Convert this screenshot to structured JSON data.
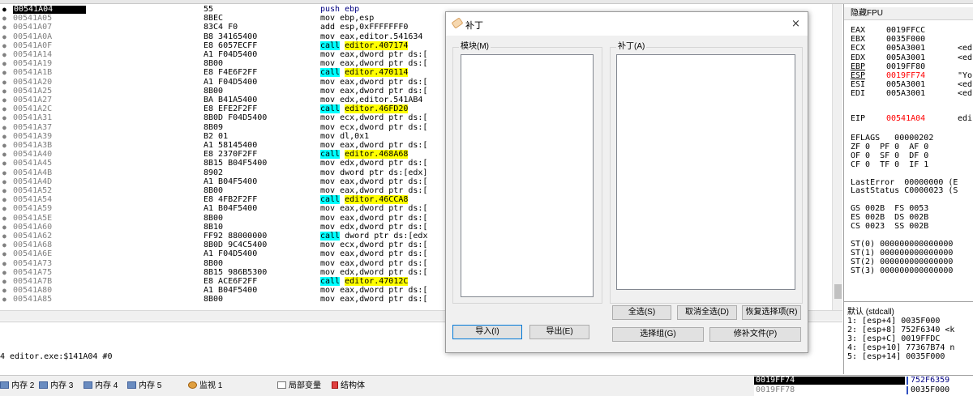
{
  "disasm_rows": [
    {
      "addr": "00541A04",
      "hex": "55",
      "ins": [
        [
          "kw",
          "push ebp"
        ]
      ],
      "sel": true
    },
    {
      "addr": "00541A05",
      "hex": "8BEC",
      "ins": [
        [
          "t",
          "mov ebp,esp"
        ]
      ]
    },
    {
      "addr": "00541A07",
      "hex": "83C4 F0",
      "ins": [
        [
          "t",
          "add esp,0xFFFFFFF0"
        ]
      ]
    },
    {
      "addr": "00541A0A",
      "hex": "B8 34165400",
      "ins": [
        [
          "t",
          "mov eax,editor.541634"
        ]
      ]
    },
    {
      "addr": "00541A0F",
      "hex": "E8 6057ECFF",
      "ins": [
        [
          "call",
          "call"
        ],
        [
          "t",
          " "
        ],
        [
          "tgt",
          "editor.407174"
        ]
      ]
    },
    {
      "addr": "00541A14",
      "hex": "A1 F04D5400",
      "ins": [
        [
          "t",
          "mov eax,dword ptr ds:["
        ]
      ]
    },
    {
      "addr": "00541A19",
      "hex": "8B00",
      "ins": [
        [
          "t",
          "mov eax,dword ptr ds:["
        ]
      ]
    },
    {
      "addr": "00541A1B",
      "hex": "E8 F4E6F2FF",
      "ins": [
        [
          "call",
          "call"
        ],
        [
          "t",
          " "
        ],
        [
          "tgt",
          "editor.470114"
        ]
      ]
    },
    {
      "addr": "00541A20",
      "hex": "A1 F04D5400",
      "ins": [
        [
          "t",
          "mov eax,dword ptr ds:["
        ]
      ]
    },
    {
      "addr": "00541A25",
      "hex": "8B00",
      "ins": [
        [
          "t",
          "mov eax,dword ptr ds:["
        ]
      ]
    },
    {
      "addr": "00541A27",
      "hex": "BA B41A5400",
      "ins": [
        [
          "t",
          "mov edx,editor.541AB4"
        ]
      ]
    },
    {
      "addr": "00541A2C",
      "hex": "E8 EFE2F2FF",
      "ins": [
        [
          "call",
          "call"
        ],
        [
          "t",
          " "
        ],
        [
          "tgt",
          "editor.46FD20"
        ]
      ]
    },
    {
      "addr": "00541A31",
      "hex": "8B0D F04D5400",
      "ins": [
        [
          "t",
          "mov ecx,dword ptr ds:["
        ]
      ]
    },
    {
      "addr": "00541A37",
      "hex": "8B09",
      "ins": [
        [
          "t",
          "mov ecx,dword ptr ds:["
        ]
      ]
    },
    {
      "addr": "00541A39",
      "hex": "B2 01",
      "ins": [
        [
          "t",
          "mov dl,0x1"
        ]
      ]
    },
    {
      "addr": "00541A3B",
      "hex": "A1 58145400",
      "ins": [
        [
          "t",
          "mov eax,dword ptr ds:["
        ]
      ]
    },
    {
      "addr": "00541A40",
      "hex": "E8 2370F2FF",
      "ins": [
        [
          "call",
          "call"
        ],
        [
          "t",
          " "
        ],
        [
          "tgt",
          "editor.468A68"
        ]
      ]
    },
    {
      "addr": "00541A45",
      "hex": "8B15 B04F5400",
      "ins": [
        [
          "t",
          "mov edx,dword ptr ds:["
        ]
      ]
    },
    {
      "addr": "00541A4B",
      "hex": "8902",
      "ins": [
        [
          "t",
          "mov dword ptr ds:[edx]"
        ]
      ]
    },
    {
      "addr": "00541A4D",
      "hex": "A1 B04F5400",
      "ins": [
        [
          "t",
          "mov eax,dword ptr ds:["
        ]
      ]
    },
    {
      "addr": "00541A52",
      "hex": "8B00",
      "ins": [
        [
          "t",
          "mov eax,dword ptr ds:["
        ]
      ]
    },
    {
      "addr": "00541A54",
      "hex": "E8 4FB2F2FF",
      "ins": [
        [
          "call",
          "call"
        ],
        [
          "t",
          " "
        ],
        [
          "tgt",
          "editor.46CCA8"
        ]
      ]
    },
    {
      "addr": "00541A59",
      "hex": "A1 B04F5400",
      "ins": [
        [
          "t",
          "mov eax,dword ptr ds:["
        ]
      ]
    },
    {
      "addr": "00541A5E",
      "hex": "8B00",
      "ins": [
        [
          "t",
          "mov eax,dword ptr ds:["
        ]
      ]
    },
    {
      "addr": "00541A60",
      "hex": "8B10",
      "ins": [
        [
          "t",
          "mov edx,dword ptr ds:["
        ]
      ]
    },
    {
      "addr": "00541A62",
      "hex": "FF92 88000000",
      "ins": [
        [
          "call",
          "call"
        ],
        [
          "t",
          " dword ptr ds:[edx"
        ]
      ]
    },
    {
      "addr": "00541A68",
      "hex": "8B0D 9C4C5400",
      "ins": [
        [
          "t",
          "mov ecx,dword ptr ds:["
        ]
      ]
    },
    {
      "addr": "00541A6E",
      "hex": "A1 F04D5400",
      "ins": [
        [
          "t",
          "mov eax,dword ptr ds:["
        ]
      ]
    },
    {
      "addr": "00541A73",
      "hex": "8B00",
      "ins": [
        [
          "t",
          "mov eax,dword ptr ds:["
        ]
      ]
    },
    {
      "addr": "00541A75",
      "hex": "8B15 986B5300",
      "ins": [
        [
          "t",
          "mov edx,dword ptr ds:["
        ]
      ]
    },
    {
      "addr": "00541A7B",
      "hex": "E8 ACE6F2FF",
      "ins": [
        [
          "call",
          "call"
        ],
        [
          "t",
          " "
        ],
        [
          "tgt",
          "editor.47012C"
        ]
      ]
    },
    {
      "addr": "00541A80",
      "hex": "A1 B04F5400",
      "ins": [
        [
          "t",
          "mov eax,dword ptr ds:["
        ]
      ]
    },
    {
      "addr": "00541A85",
      "hex": "8B00",
      "ins": [
        [
          "t",
          "mov eax,dword ptr ds:["
        ]
      ]
    }
  ],
  "status_line": "4 editor.exe:$141A04 #0",
  "registers": {
    "header": "隐藏FPU",
    "gp": [
      {
        "name": "EAX",
        "value": "0019FFCC",
        "comment": ""
      },
      {
        "name": "EBX",
        "value": "0035F000",
        "comment": ""
      },
      {
        "name": "ECX",
        "value": "005A3001",
        "comment": "<ed"
      },
      {
        "name": "EDX",
        "value": "005A3001",
        "comment": "<ed"
      },
      {
        "name": "EBP",
        "value": "0019FF80",
        "comment": "",
        "underline": true
      },
      {
        "name": "ESP",
        "value": "0019FF74",
        "comment": "\"Yo",
        "underline": true,
        "red": true
      },
      {
        "name": "ESI",
        "value": "005A3001",
        "comment": "<ed"
      },
      {
        "name": "EDI",
        "value": "005A3001",
        "comment": "<ed"
      }
    ],
    "eip": {
      "name": "EIP",
      "value": "00541A04",
      "comment": "edi"
    },
    "lines": [
      "EFLAGS   00000202",
      "ZF 0  PF 0  AF 0",
      "OF 0  SF 0  DF 0",
      "CF 0  TF 0  IF 1",
      "",
      "LastError  00000000 (E",
      "LastStatus C0000023 (S",
      "",
      "GS 002B  FS 0053",
      "ES 002B  DS 002B",
      "CS 0023  SS 002B",
      "",
      "ST(0) 000000000000000",
      "ST(1) 000000000000000",
      "ST(2) 000000000000000",
      "ST(3) 000000000000000"
    ]
  },
  "stack_args": {
    "header": "默认 (stdcall)",
    "items": [
      "1: [esp+4] 0035F000",
      "2: [esp+8] 752F6340 <k",
      "3: [esp+C] 0019FFDC",
      "4: [esp+10] 77367B74 n",
      "5: [esp+14] 0035F000"
    ]
  },
  "bottom_tabs": [
    "内存 2",
    "内存 3",
    "内存 4",
    "内存 5",
    "监视 1",
    "局部变量",
    "结构体"
  ],
  "stack_pane": {
    "addr1": "0019FF74",
    "addr2": "0019FF78",
    "val1": "752F6359",
    "val2": "0035F000"
  },
  "dialog": {
    "title": "补丁",
    "close": "×",
    "module_label": "模块(M)",
    "patch_label": "补丁(A)",
    "buttons": {
      "select_all": "全选(S)",
      "deselect_all": "取消全选(D)",
      "restore_selection": "恢复选择项(R)",
      "import": "导入(I)",
      "export": "导出(E)",
      "select_group": "选择组(G)",
      "patch_file": "修补文件(P)"
    }
  }
}
